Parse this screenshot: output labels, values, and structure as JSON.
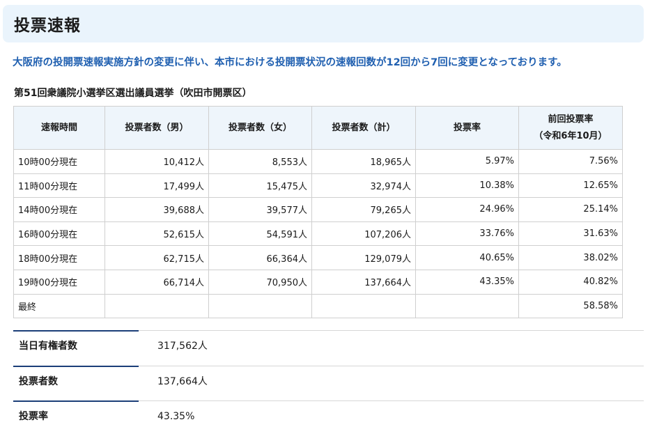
{
  "page_title": "投票速報",
  "notice": "大阪府の投開票速報実施方針の変更に伴い、本市における投開票状況の速報回数が12回から7回に変更となっております。",
  "table_caption": "第51回衆議院小選挙区選出議員選挙（吹田市開票区）",
  "table": {
    "headers": [
      "速報時間",
      "投票者数（男）",
      "投票者数（女）",
      "投票者数（計）",
      "投票率",
      "前回投票率",
      "（令和6年10月）"
    ],
    "rows": [
      [
        "10時00分現在",
        "10,412人",
        "8,553人",
        "18,965人",
        "5.97%",
        "7.56%"
      ],
      [
        "11時00分現在",
        "17,499人",
        "15,475人",
        "32,974人",
        "10.38%",
        "12.65%"
      ],
      [
        "14時00分現在",
        "39,688人",
        "39,577人",
        "79,265人",
        "24.96%",
        "25.14%"
      ],
      [
        "16時00分現在",
        "52,615人",
        "54,591人",
        "107,206人",
        "33.76%",
        "31.63%"
      ],
      [
        "18時00分現在",
        "62,715人",
        "66,364人",
        "129,079人",
        "40.65%",
        "38.02%"
      ],
      [
        "19時00分現在",
        "66,714人",
        "70,950人",
        "137,664人",
        "43.35%",
        "40.82%"
      ],
      [
        "最終",
        "",
        "",
        "",
        "",
        "58.58%"
      ]
    ]
  },
  "summary": [
    {
      "label": "当日有権者数",
      "value": "317,562人"
    },
    {
      "label": "投票者数",
      "value": "137,664人"
    },
    {
      "label": "投票率",
      "value": "43.35%"
    }
  ],
  "colors": {
    "banner_bg": "#eaf4fc",
    "notice_text": "#1f5fb0",
    "header_bg": "#eef5fb",
    "accent_line": "#1b3e78"
  }
}
